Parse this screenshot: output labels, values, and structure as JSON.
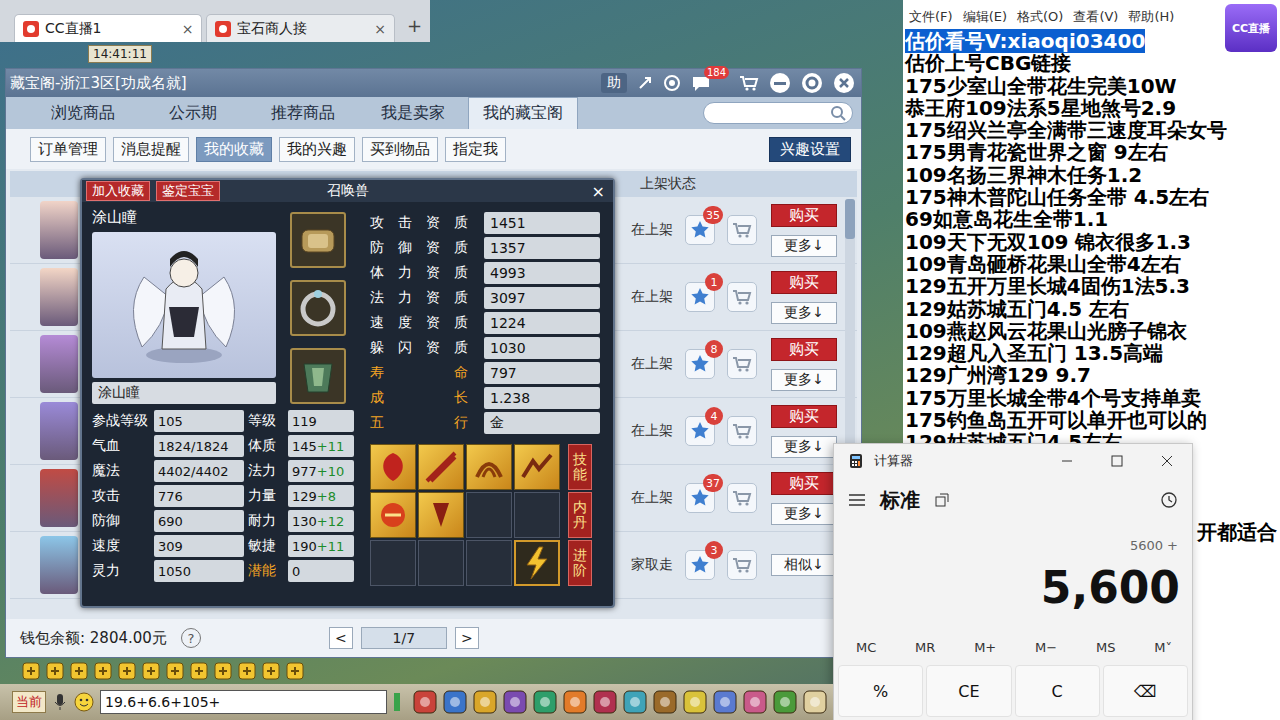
{
  "browser_tabs": [
    {
      "label": "CC直播1",
      "close": "×",
      "selected": true
    },
    {
      "label": "宝石商人接",
      "close": "×",
      "selected": false
    }
  ],
  "new_tab": "+",
  "game_hud": {
    "clock": "14:41:11"
  },
  "cbg": {
    "title": "藏宝阁-浙江3区[功成名就]",
    "help": "助",
    "msg_badge": "184",
    "nav": [
      {
        "label": "浏览商品",
        "selected": false
      },
      {
        "label": "公示期",
        "selected": false
      },
      {
        "label": "推荐商品",
        "selected": false
      },
      {
        "label": "我是卖家",
        "selected": false
      },
      {
        "label": "我的藏宝阁",
        "selected": true
      }
    ],
    "subnav": [
      {
        "label": "订单管理",
        "selected": false
      },
      {
        "label": "消息提醒",
        "selected": false
      },
      {
        "label": "我的收藏",
        "selected": true
      },
      {
        "label": "我的兴趣",
        "selected": false
      },
      {
        "label": "买到物品",
        "selected": false
      },
      {
        "label": "指定我",
        "selected": false
      }
    ],
    "interest_button": "兴趣设置",
    "column_status": "上架状态",
    "rows": [
      {
        "status": "在上架",
        "favorites": "35",
        "kind": "buy",
        "buy": "购买",
        "more": "更多↓"
      },
      {
        "status": "在上架",
        "favorites": "1",
        "kind": "buy",
        "buy": "购买",
        "more": "更多↓"
      },
      {
        "status": "在上架",
        "favorites": "8",
        "kind": "buy",
        "buy": "购买",
        "more": "更多↓"
      },
      {
        "status": "在上架",
        "favorites": "4",
        "kind": "buy",
        "buy": "购买",
        "more": "更多↓"
      },
      {
        "status": "在上架",
        "favorites": "37",
        "kind": "buy",
        "buy": "购买",
        "more": "更多↓"
      },
      {
        "status": "家取走",
        "favorites": "3",
        "kind": "similar",
        "more": "相似↓"
      }
    ],
    "wallet": "钱包余额: 2804.00元",
    "help_mark": "?",
    "pager": {
      "prev": "<",
      "page": "1/7",
      "next": ">"
    }
  },
  "pet_popup": {
    "add_fav": "加入收藏",
    "appraise": "鉴定宝宝",
    "title": "召唤兽",
    "close": "×",
    "name": "涂山瞳",
    "name_field": "涂山瞳",
    "aptitudes": [
      {
        "label": "攻 击 资 质",
        "value": "1451",
        "kind": "normal"
      },
      {
        "label": "防 御 资 质",
        "value": "1357",
        "kind": "normal"
      },
      {
        "label": "体 力 资 质",
        "value": "4993",
        "kind": "normal"
      },
      {
        "label": "法 力 资 质",
        "value": "3097",
        "kind": "normal"
      },
      {
        "label": "速 度 资 质",
        "value": "1224",
        "kind": "normal"
      },
      {
        "label": "躲 闪 资 质",
        "value": "1030",
        "kind": "normal"
      },
      {
        "label": "寿 命",
        "value": "797",
        "kind": "highlight"
      },
      {
        "label": "成 长",
        "value": "1.238",
        "kind": "highlight"
      },
      {
        "label": "五 行",
        "value": "金",
        "kind": "highlight"
      }
    ],
    "stats": [
      {
        "label": "参战等级",
        "value": "105",
        "kind": "normal"
      },
      {
        "label": "等级",
        "value": "119",
        "kind": "normal"
      },
      {
        "label": "气血",
        "value": "1824/1824",
        "kind": "normal"
      },
      {
        "label": "体质",
        "value": "145",
        "bonus": "+11",
        "kind": "normal"
      },
      {
        "label": "魔法",
        "value": "4402/4402",
        "kind": "normal"
      },
      {
        "label": "法力",
        "value": "977",
        "bonus": "+10",
        "kind": "normal"
      },
      {
        "label": "攻击",
        "value": "776",
        "kind": "normal"
      },
      {
        "label": "力量",
        "value": "129",
        "bonus": "+8",
        "kind": "normal"
      },
      {
        "label": "防御",
        "value": "690",
        "kind": "normal"
      },
      {
        "label": "耐力",
        "value": "130",
        "bonus": "+12",
        "kind": "normal"
      },
      {
        "label": "速度",
        "value": "309",
        "kind": "normal"
      },
      {
        "label": "敏捷",
        "value": "190",
        "bonus": "+11",
        "kind": "normal"
      },
      {
        "label": "灵力",
        "value": "1050",
        "kind": "normal"
      },
      {
        "label": "潜能",
        "value": "0",
        "kind": "highlight"
      }
    ],
    "skills": [
      {
        "kind": "skill"
      },
      {
        "kind": "skill"
      },
      {
        "kind": "skill"
      },
      {
        "kind": "skill"
      },
      {
        "kind": "skill"
      },
      {
        "kind": "skill"
      },
      {
        "kind": "empty"
      },
      {
        "kind": "empty"
      },
      {
        "kind": "empty"
      },
      {
        "kind": "empty"
      },
      {
        "kind": "empty"
      },
      {
        "kind": "special"
      }
    ],
    "side_tabs": [
      "技能",
      "内丹",
      "进阶"
    ]
  },
  "notepad": {
    "menu": [
      "文件(F)",
      "编辑(E)",
      "格式(O)",
      "查看(V)",
      "帮助(H)"
    ],
    "lines": [
      {
        "text": "估价看号V:xiaoqi03400",
        "selected": true
      },
      {
        "text": "估价上号CBG链接",
        "selected": false
      },
      {
        "text": "175少室山全带花生完美10W",
        "selected": false
      },
      {
        "text": "恭王府109法系5星地煞号2.9",
        "selected": false
      },
      {
        "text": "175绍兴兰亭全满带三速度耳朵女号",
        "selected": false
      },
      {
        "text": "175男青花瓷世界之窗  9左右",
        "selected": false
      },
      {
        "text": "109名扬三界神木任务1.2",
        "selected": false
      },
      {
        "text": "175神木普陀山任务全带 4.5左右",
        "selected": false
      },
      {
        "text": "69如意岛花生全带1.1",
        "selected": false
      },
      {
        "text": "109天下无双109  锦衣很多1.3",
        "selected": false
      },
      {
        "text": "109青岛砸桥花果山全带4左右",
        "selected": false
      },
      {
        "text": "129五开万里长城4固伤1法5.3",
        "selected": false
      },
      {
        "text": "129姑苏城五门4.5 左右",
        "selected": false
      },
      {
        "text": "109燕赵风云花果山光膀子锦衣",
        "selected": false
      },
      {
        "text": "129超凡入圣五门  13.5高端",
        "selected": false
      },
      {
        "text": "129广州湾129 9.7",
        "selected": false
      },
      {
        "text": "175万里长城全带4个号支持单卖",
        "selected": false
      },
      {
        "text": "175钓鱼岛五开可以单开也可以的",
        "selected": false
      },
      {
        "text": "129姑苏城五门4.5左右",
        "selected": false
      }
    ],
    "fragment": "开都适合"
  },
  "logo": "CC直播",
  "calculator": {
    "title": "计算器",
    "mode": "标准",
    "history": "5600 +",
    "display": "5,600",
    "memory": [
      "MC",
      "MR",
      "M+",
      "M−",
      "MS",
      "M˅"
    ],
    "keys": [
      "%",
      "CE",
      "C",
      "⌫"
    ]
  },
  "chat": {
    "channel": "当前",
    "input": "19.6+6.6+105+"
  }
}
